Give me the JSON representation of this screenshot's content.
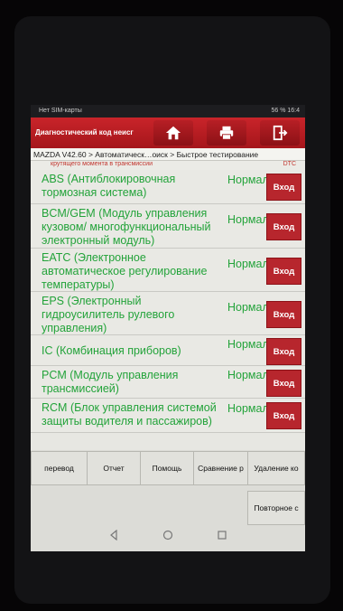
{
  "status_bar": {
    "carrier": "Нет SIM-карты",
    "right": "56 %  16:4"
  },
  "toolbar": {
    "title": "Диагностический код неисг",
    "icons": [
      "home-icon",
      "print-icon",
      "exit-icon"
    ]
  },
  "breadcrumb": "MAZDA V42.60 > Автоматическ…оиск > Быстрое тестирование",
  "subheader": {
    "text": "крутящего момента в трансмиссии",
    "dtc": "DTC"
  },
  "modules": [
    {
      "name": "ABS (Антиблокировочная тормозная система)",
      "status": "Нормально",
      "enter": "Вход"
    },
    {
      "name": "BCM/GEM (Модуль управления кузовом/ многофункциональный электронный модуль)",
      "status": "Нормально",
      "enter": "Вход"
    },
    {
      "name": "EATC (Электронное автоматическое регулирование температуры)",
      "status": "Нормально",
      "enter": "Вход"
    },
    {
      "name": "EPS (Электронный гидроусилитель рулевого управления)",
      "status": "Нормально",
      "enter": "Вход"
    },
    {
      "name": "IC (Комбинация приборов)",
      "status": "Нормально",
      "enter": "Вход"
    },
    {
      "name": "PCM (Модуль управления трансмиссией)",
      "status": "Нормально",
      "enter": "Вход"
    },
    {
      "name": "RCM (Блок управления системой защиты водителя и пассажиров)",
      "status": "Нормально",
      "enter": "Вход"
    }
  ],
  "bottom_buttons": [
    "перевод",
    "Отчет",
    "Помощь",
    "Сравнение р",
    "Удаление ко",
    "Повторное с"
  ]
}
